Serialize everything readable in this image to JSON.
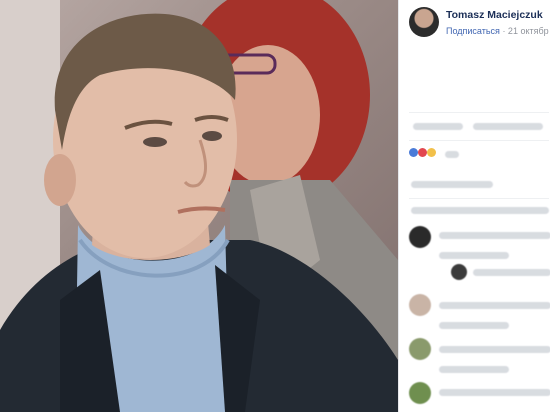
{
  "post": {
    "author": "Tomasz Maciejczuk",
    "subscribe": "Подписаться",
    "date": "· 21 октябр"
  },
  "colors": {
    "fb_author": "#1c2f57",
    "fb_link": "#4267b2",
    "fb_meta": "#90949c",
    "suit": "#232a33",
    "turtleneck": "#9fb7d3",
    "background_hair": "#a5322a"
  }
}
